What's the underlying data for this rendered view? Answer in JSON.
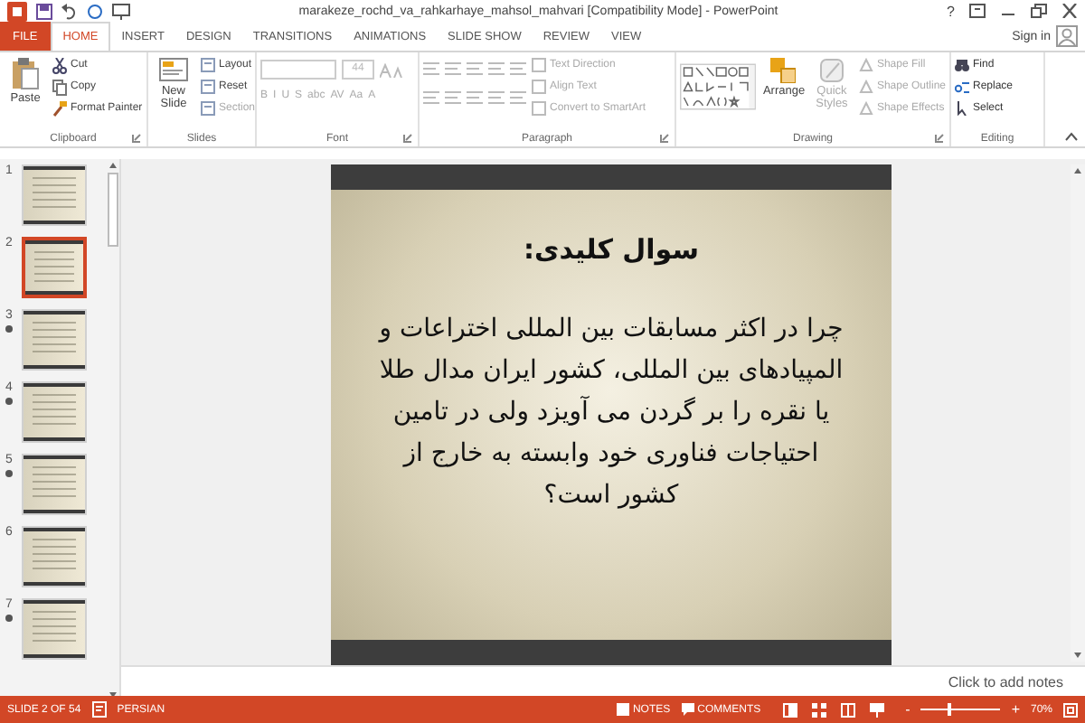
{
  "window": {
    "title": "marakeze_rochd_va_rahkarhaye_mahsol_mahvari [Compatibility Mode] - PowerPoint",
    "help": "?",
    "sign_in": "Sign in"
  },
  "tabs": [
    {
      "label": "FILE",
      "kind": "file",
      "selected": false
    },
    {
      "label": "HOME",
      "kind": "tab",
      "selected": true
    },
    {
      "label": "INSERT",
      "kind": "tab",
      "selected": false
    },
    {
      "label": "DESIGN",
      "kind": "tab",
      "selected": false
    },
    {
      "label": "TRANSITIONS",
      "kind": "tab",
      "selected": false
    },
    {
      "label": "ANIMATIONS",
      "kind": "tab",
      "selected": false
    },
    {
      "label": "SLIDE SHOW",
      "kind": "tab",
      "selected": false
    },
    {
      "label": "REVIEW",
      "kind": "tab",
      "selected": false
    },
    {
      "label": "VIEW",
      "kind": "tab",
      "selected": false
    }
  ],
  "clipboard": {
    "label": "Clipboard",
    "paste": "Paste",
    "items": [
      "Cut",
      "Copy",
      "Format Painter"
    ]
  },
  "slides_group": {
    "label": "Slides",
    "new_slide": "New Slide",
    "items": [
      {
        "label": "Layout",
        "disabled": false
      },
      {
        "label": "Reset",
        "disabled": false
      },
      {
        "label": "Section",
        "disabled": true
      }
    ]
  },
  "font": {
    "label": "Font",
    "size": "44",
    "format_buttons": [
      "B",
      "I",
      "U",
      "S",
      "abc",
      "AV",
      "Aa",
      "A"
    ]
  },
  "paragraph": {
    "label": "Paragraph",
    "items": [
      {
        "label": "Text Direction",
        "disabled": true
      },
      {
        "label": "Align Text",
        "disabled": true
      },
      {
        "label": "Convert to SmartArt",
        "disabled": true
      }
    ]
  },
  "drawing": {
    "label": "Drawing",
    "arrange": "Arrange",
    "quick_styles": "Quick Styles",
    "items": [
      {
        "label": "Shape Fill",
        "disabled": true
      },
      {
        "label": "Shape Outline",
        "disabled": true
      },
      {
        "label": "Shape Effects",
        "disabled": true
      }
    ]
  },
  "editing": {
    "label": "Editing",
    "items": [
      "Find",
      "Replace",
      "Select"
    ]
  },
  "thumbnails": [
    {
      "number": "1",
      "selected": false,
      "animated": false
    },
    {
      "number": "2",
      "selected": true,
      "animated": false
    },
    {
      "number": "3",
      "selected": false,
      "animated": true
    },
    {
      "number": "4",
      "selected": false,
      "animated": true
    },
    {
      "number": "5",
      "selected": false,
      "animated": true
    },
    {
      "number": "6",
      "selected": false,
      "animated": false
    },
    {
      "number": "7",
      "selected": false,
      "animated": true
    }
  ],
  "slide": {
    "title": "سوال کلیدی:",
    "body": "چرا در اکثر مسابقات بین المللی اختراعات و المپیادهای بین المللی، کشور ایران مدال طلا یا نقره را بر گردن می آویزد ولی در تامین احتیاجات فناوری خود وابسته به خارج از کشور است؟"
  },
  "notes": {
    "placeholder": "Click to add notes"
  },
  "status_bar": {
    "slide": "SLIDE 2 OF 54",
    "language": "PERSIAN",
    "notes": "NOTES",
    "comments": "COMMENTS",
    "zoom_out": "-",
    "zoom_in": "+",
    "zoom": "70%",
    "zoom_slider": {
      "level": 0.34
    }
  }
}
